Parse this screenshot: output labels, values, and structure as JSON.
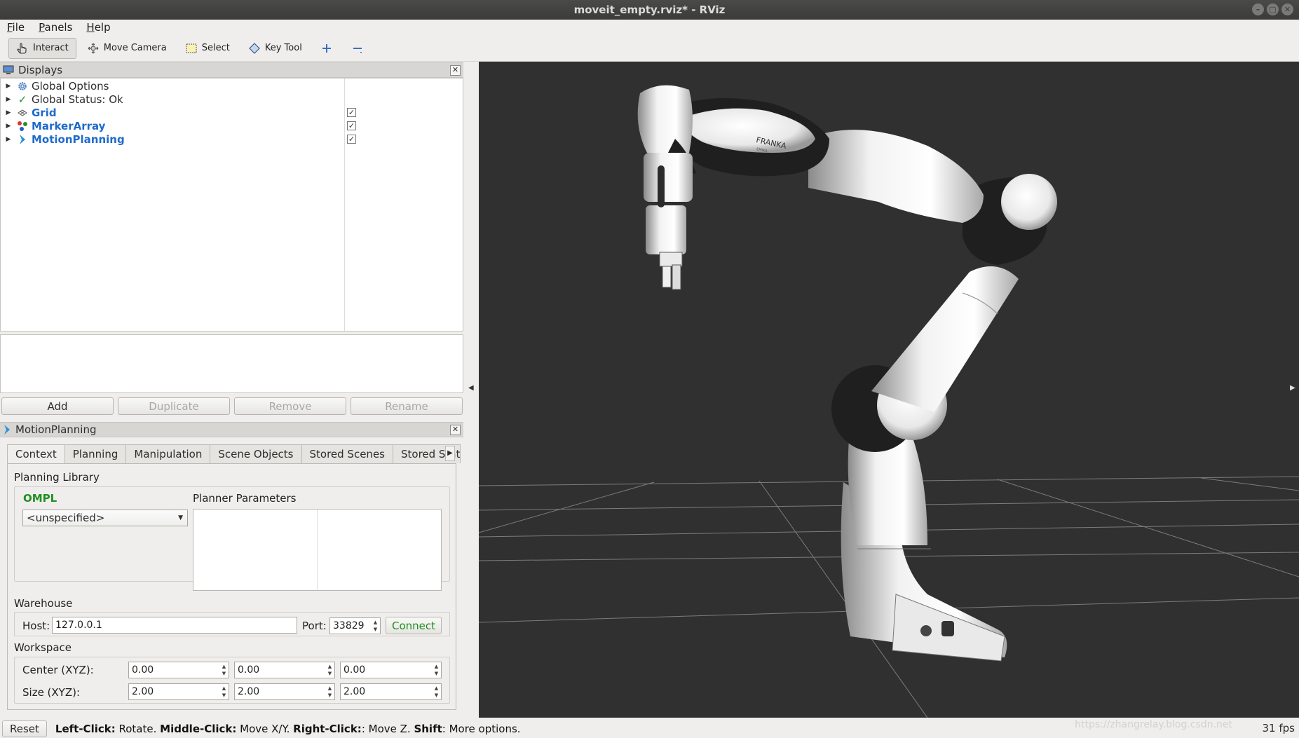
{
  "window": {
    "title": "moveit_empty.rviz* - RViz",
    "controls": [
      "–",
      "▢",
      "✕"
    ]
  },
  "menu": [
    {
      "label": "File",
      "key": "F",
      "rest": "ile"
    },
    {
      "label": "Panels",
      "key": "P",
      "rest": "anels"
    },
    {
      "label": "Help",
      "key": "H",
      "rest": "elp"
    }
  ],
  "toolbar": {
    "interact": "Interact",
    "move_camera": "Move Camera",
    "select": "Select",
    "key_tool": "Key Tool"
  },
  "displays": {
    "title": "Displays",
    "items": [
      {
        "label": "Global Options",
        "icon": "gear-icon",
        "checked": null
      },
      {
        "label": "Global Status: Ok",
        "icon": "check-icon",
        "checked": null
      },
      {
        "label": "Grid",
        "icon": "grid-icon",
        "checked": true
      },
      {
        "label": "MarkerArray",
        "icon": "marker-icon",
        "checked": true
      },
      {
        "label": "MotionPlanning",
        "icon": "motion-icon",
        "checked": true
      }
    ],
    "buttons": {
      "add": "Add",
      "duplicate": "Duplicate",
      "remove": "Remove",
      "rename": "Rename"
    }
  },
  "motion_planning": {
    "title": "MotionPlanning",
    "tabs": [
      "Context",
      "Planning",
      "Manipulation",
      "Scene Objects",
      "Stored Scenes",
      "Stored State"
    ],
    "planning_library_label": "Planning Library",
    "library": "OMPL",
    "planner": "<unspecified>",
    "planner_params_label": "Planner Parameters",
    "warehouse_label": "Warehouse",
    "host_label": "Host:",
    "host": "127.0.0.1",
    "port_label": "Port:",
    "port": "33829",
    "connect": "Connect",
    "workspace_label": "Workspace",
    "center_label": "Center (XYZ):",
    "center": [
      "0.00",
      "0.00",
      "0.00"
    ],
    "size_label": "Size (XYZ):",
    "size": [
      "2.00",
      "2.00",
      "2.00"
    ]
  },
  "viewport": {
    "brand_text": "FRANKA",
    "brand_sub": "EMIKA"
  },
  "status": {
    "reset": "Reset",
    "hint": [
      {
        "b": "Left-Click:",
        "t": " Rotate. "
      },
      {
        "b": "Middle-Click:",
        "t": " Move X/Y. "
      },
      {
        "b": "Right-Click:",
        "t": ": Move Z. "
      },
      {
        "b": "Shift",
        "t": ": More options."
      }
    ],
    "fps": "31 fps",
    "watermark": "https://zhangrelay.blog.csdn.net"
  }
}
